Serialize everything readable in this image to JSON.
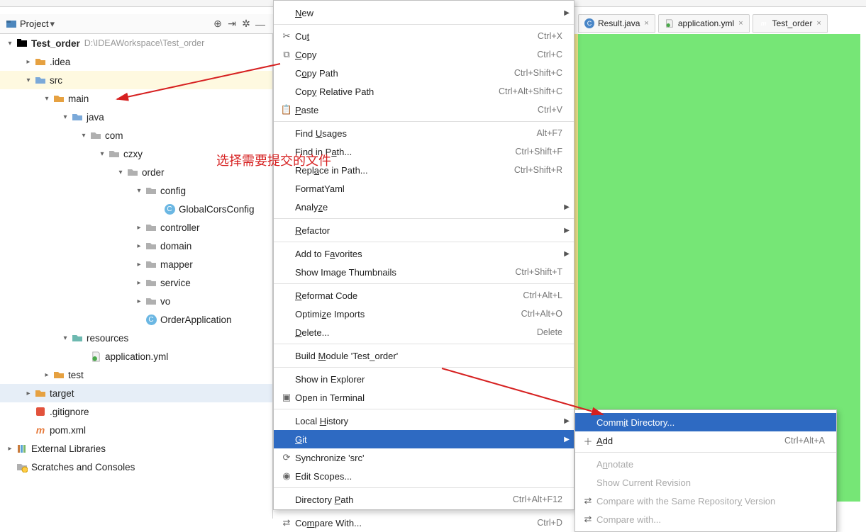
{
  "toolbar": {
    "label": "Project"
  },
  "project": {
    "name": "Test_order",
    "path": "D:\\IDEAWorkspace\\Test_order"
  },
  "tree": {
    "idea": ".idea",
    "src": "src",
    "main": "main",
    "java": "java",
    "com": "com",
    "czxy": "czxy",
    "order": "order",
    "config": "config",
    "globalcors": "GlobalCorsConfig",
    "controller": "controller",
    "domain": "domain",
    "mapper": "mapper",
    "service": "service",
    "vo": "vo",
    "orderapp": "OrderApplication",
    "resources": "resources",
    "appyml": "application.yml",
    "test": "test",
    "target": "target",
    "gitignore": ".gitignore",
    "pom": "pom.xml",
    "extlib": "External Libraries",
    "scratches": "Scratches and Consoles"
  },
  "tabs": {
    "result": "Result.java",
    "appyml": "application.yml",
    "testorder": "Test_order"
  },
  "menu": {
    "new": "New",
    "cut": "Cut",
    "cut_sc": "Ctrl+X",
    "copy": "Copy",
    "copy_sc": "Ctrl+C",
    "copypath": "Copy Path",
    "copypath_sc": "Ctrl+Shift+C",
    "copyrel": "Copy Relative Path",
    "copyrel_sc": "Ctrl+Alt+Shift+C",
    "paste": "Paste",
    "paste_sc": "Ctrl+V",
    "findusages": "Find Usages",
    "findusages_sc": "Alt+F7",
    "findinpath": "Find in Path...",
    "findinpath_sc": "Ctrl+Shift+F",
    "replinpath": "Replace in Path...",
    "replinpath_sc": "Ctrl+Shift+R",
    "formatyaml": "FormatYaml",
    "analyze": "Analyze",
    "refactor": "Refactor",
    "addfav": "Add to Favorites",
    "showthumbs": "Show Image Thumbnails",
    "showthumbs_sc": "Ctrl+Shift+T",
    "reformat": "Reformat Code",
    "reformat_sc": "Ctrl+Alt+L",
    "optimports": "Optimize Imports",
    "optimports_sc": "Ctrl+Alt+O",
    "delete": "Delete...",
    "delete_sc": "Delete",
    "buildmod": "Build Module 'Test_order'",
    "showexpl": "Show in Explorer",
    "openterm": "Open in Terminal",
    "localhist": "Local History",
    "git": "Git",
    "sync": "Synchronize 'src'",
    "editscopes": "Edit Scopes...",
    "dirpath": "Directory Path",
    "dirpath_sc": "Ctrl+Alt+F12",
    "compwith": "Compare With...",
    "compwith_sc": "Ctrl+D"
  },
  "submenu": {
    "commit": "Commit Directory...",
    "add": "Add",
    "add_sc": "Ctrl+Alt+A",
    "annotate": "Annotate",
    "showrev": "Show Current Revision",
    "compsame": "Compare with the Same Repository Version",
    "compwith": "Compare with..."
  },
  "annotation": "选择需要提交的文件"
}
